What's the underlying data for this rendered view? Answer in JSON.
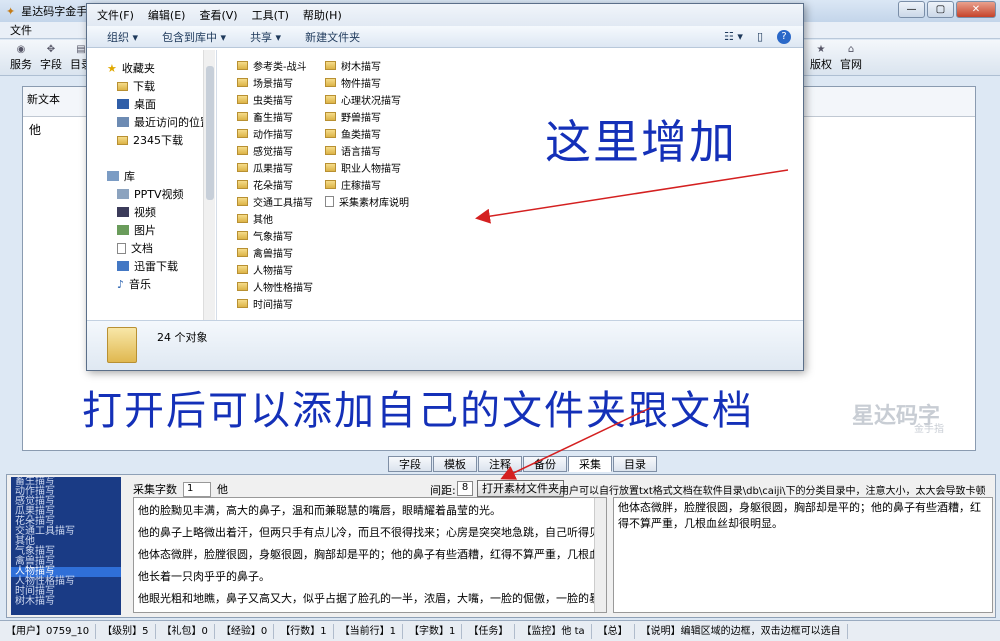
{
  "app": {
    "title": "星达码字金手指",
    "menubar": "文件",
    "toolbar": [
      "服务",
      "字段",
      "目录",
      "版权",
      "官网"
    ],
    "doc_tab": "新文本",
    "doc_content": "他",
    "watermark": "星达码字",
    "watermark_sub": "金手指"
  },
  "explorer": {
    "menu": [
      "文件(F)",
      "编辑(E)",
      "查看(V)",
      "工具(T)",
      "帮助(H)"
    ],
    "commands": [
      "组织 ▾",
      "包含到库中 ▾",
      "共享 ▾",
      "新建文件夹"
    ],
    "nav": [
      "收藏夹",
      "下载",
      "桌面",
      "最近访问的位置",
      "2345下载",
      "库",
      "PPTV视频",
      "视频",
      "图片",
      "文档",
      "迅雷下载",
      "音乐"
    ],
    "files_col1": [
      "参考类-战斗",
      "场景描写",
      "虫类描写",
      "畜生描写",
      "动作描写",
      "感觉描写",
      "瓜果描写",
      "花朵描写",
      "交通工具描写",
      "其他",
      "气象描写",
      "禽兽描写",
      "人物描写",
      "人物性格描写",
      "时间描写"
    ],
    "files_col2": [
      "树木描写",
      "物件描写",
      "心理状况描写",
      "野兽描写",
      "鱼类描写",
      "语言描写",
      "职业人物描写",
      "庄稼描写",
      "采集素材库说明"
    ],
    "count": "24 个对象"
  },
  "annotations": {
    "top": "这里增加",
    "bottom": "打开后可以添加自己的文件夹跟文档"
  },
  "bottom_tabs": [
    "字段",
    "模板",
    "注释",
    "备份",
    "采集",
    "目录"
  ],
  "collect": {
    "categories": [
      "畜生描写",
      "动作描写",
      "感觉描写",
      "瓜果描写",
      "花朵描写",
      "交通工具描写",
      "其他",
      "气象描写",
      "禽兽描写",
      "人物描写",
      "人物性格描写",
      "时间描写",
      "树木描写"
    ],
    "selected_category": "人物描写",
    "count_label": "采集字数",
    "count_value": "1",
    "target": "他",
    "gap_label": "间距:",
    "gap_value": "8",
    "open_button": "打开素材文件夹",
    "hint": "用户可以自行放置txt格式文档在软件目录\\db\\caiji\\下的分类目录中，注意大小，太大会导致卡顿",
    "paragraphs": [
      "他的脸黝见丰满，高大的鼻子，温和而兼聪慧的嘴唇，眼睛耀着晶莹的光。",
      "他的鼻子上略微出着汗，但两只手有点儿冷，而且不很得找来；心房是突突地急跳，自己听得见那种不",
      "他体态微胖，脸膛很圆，身躯很圆，胸部却是平的；他的鼻子有些酒糟，红得不算严重，几根血丝却很明显。",
      "他长着一只肉乎乎的鼻子。",
      "他眼光粗和地瞧，鼻子又高又大，似乎占据了脸孔的一半，浓眉，大嘴，一脸的倔傲，一脸的暴戾，一脸的狰"
    ],
    "right_text": "他体态微胖，脸膛很圆，身躯很圆，胸部却是平的；他的鼻子有些酒糟，红得不算严重，几根血丝却很明显。"
  },
  "status": [
    "【用户】0759_10",
    "【级别】5",
    "【礼包】0",
    "【经验】0",
    "【行数】1",
    "【当前行】1",
    "【字数】1",
    "【任务】",
    "【监控】他 ta",
    "【总】",
    "【说明】编辑区域的边框，双击边框可以选自"
  ]
}
